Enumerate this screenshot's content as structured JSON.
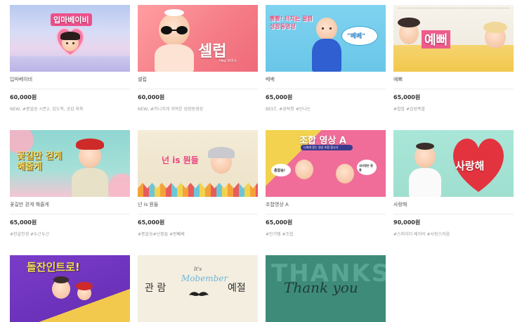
{
  "products": [
    {
      "title": "입마베이비",
      "thumb_text": "입마베이비",
      "price": "60,000원",
      "tags": "NEW, #종알송 시즌2, 입도적, 공감 육육"
    },
    {
      "title": "셀럽",
      "thumb_text": "셀럽",
      "thumb_sub": "Hey 쓰이스",
      "price": "60,000원",
      "tags": "NEW, #키니치게 귀여운 성장동영상"
    },
    {
      "title": "베베",
      "thumb_text": "빵빵! 터지는 꿀잼 성장동영상",
      "thumb_bubble": "\"베베\"",
      "price": "65,000원",
      "tags": "BEST, #성탁청 #단나는"
    },
    {
      "title": "예뻐",
      "thumb_text": "예뻐",
      "price": "65,000원",
      "tags": "#힙합 #감성폭발"
    },
    {
      "title": "꽃길만 걷게 해줄게",
      "thumb_text": "꽃길만 걷게 해줄게",
      "price": "65,000원",
      "tags": "#한살인생 #두근두근"
    },
    {
      "title": "넌 is 뭔들",
      "thumb_text": "넌 is 뭔들",
      "price": "65,000원",
      "tags": "#종알송#넌뭔들 #판빼쎄"
    },
    {
      "title": "조합영상 A",
      "thumb_text": "조합 영상 A",
      "thumb_sub": "나에게 맞는 영상 조합 합시다",
      "bubble_left": "종알송!",
      "bubble_right": "내사랑은 뭔들",
      "price": "65,000원",
      "tags": "#인기템 #조합"
    },
    {
      "title": "사랑해",
      "thumb_text": "사랑해",
      "price": "90,000원",
      "tags": "#스퍼이더 베이비 #사랑스러움"
    },
    {
      "title": "",
      "thumb_text": "돌잔인트로!"
    },
    {
      "title": "",
      "thumb_text": "관 람",
      "thumb_text2": "예절",
      "thumb_script_top": "It's",
      "thumb_script": "Mobember"
    },
    {
      "title": "",
      "thumb_text": "THANKS",
      "thumb_script": "Thank you"
    }
  ],
  "colors": {
    "tag": "#9a9a9a",
    "price": "#333333",
    "divider": "#ececec"
  }
}
